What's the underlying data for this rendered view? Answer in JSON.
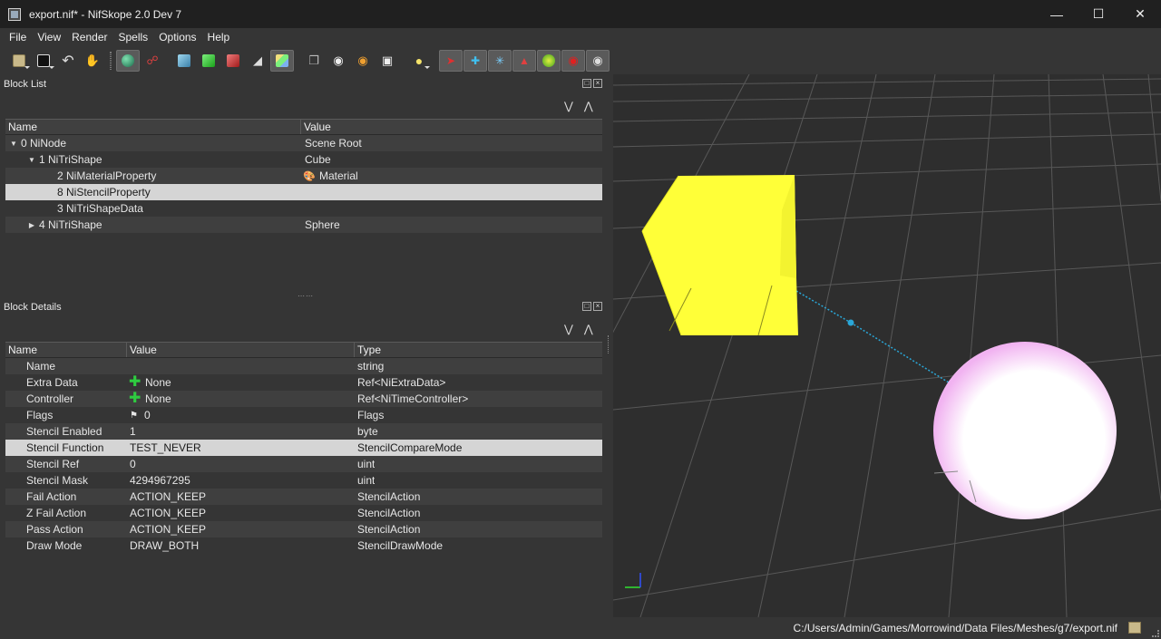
{
  "window": {
    "title": "export.nif* - NifSkope 2.0 Dev 7",
    "minimize": "—",
    "maximize": "☐",
    "close": "✕"
  },
  "menu": [
    "File",
    "View",
    "Render",
    "Spells",
    "Options",
    "Help"
  ],
  "block_list": {
    "title": "Block List",
    "columns": [
      "Name",
      "Value"
    ],
    "rows": [
      {
        "name": "0 NiNode",
        "value": "Scene Root",
        "expander": "down",
        "indent": 0
      },
      {
        "name": "1 NiTriShape",
        "value": "Cube",
        "expander": "down",
        "indent": 1
      },
      {
        "name": "2 NiMaterialProperty",
        "value": "Material",
        "expander": "",
        "indent": 2,
        "icon": "palette-icon"
      },
      {
        "name": "8 NiStencilProperty",
        "value": "",
        "expander": "",
        "indent": 2,
        "selected": true
      },
      {
        "name": "3 NiTriShapeData",
        "value": "",
        "expander": "",
        "indent": 2
      },
      {
        "name": "4 NiTriShape",
        "value": "Sphere",
        "expander": "right",
        "indent": 1
      }
    ]
  },
  "block_details": {
    "title": "Block Details",
    "columns": [
      "Name",
      "Value",
      "Type"
    ],
    "rows": [
      {
        "name": "Name",
        "value": "",
        "type": "string"
      },
      {
        "name": "Extra Data",
        "value": "None",
        "type": "Ref<NiExtraData>",
        "icon": "plus-icon"
      },
      {
        "name": "Controller",
        "value": "None",
        "type": "Ref<NiTimeController>",
        "icon": "plus-icon"
      },
      {
        "name": "Flags",
        "value": "0",
        "type": "Flags",
        "icon": "flag-icon"
      },
      {
        "name": "Stencil Enabled",
        "value": "1",
        "type": "byte"
      },
      {
        "name": "Stencil Function",
        "value": "TEST_NEVER",
        "type": "StencilCompareMode",
        "selected": true
      },
      {
        "name": "Stencil Ref",
        "value": "0",
        "type": "uint"
      },
      {
        "name": "Stencil Mask",
        "value": "4294967295",
        "type": "uint"
      },
      {
        "name": "Fail Action",
        "value": "ACTION_KEEP",
        "type": "StencilAction"
      },
      {
        "name": "Z Fail Action",
        "value": "ACTION_KEEP",
        "type": "StencilAction"
      },
      {
        "name": "Pass Action",
        "value": "ACTION_KEEP",
        "type": "StencilAction"
      },
      {
        "name": "Draw Mode",
        "value": "DRAW_BOTH",
        "type": "StencilDrawMode"
      }
    ]
  },
  "status": {
    "path": "C:/Users/Admin/Games/Morrowind/Data Files/Meshes/g7/export.nif"
  },
  "colors": {
    "cube": "#ffff3a",
    "sphere": "#ffffff",
    "sphere_glow": "#f3b7f3",
    "grid": "#5a5a5a",
    "selection_line": "#2aa7d8"
  }
}
